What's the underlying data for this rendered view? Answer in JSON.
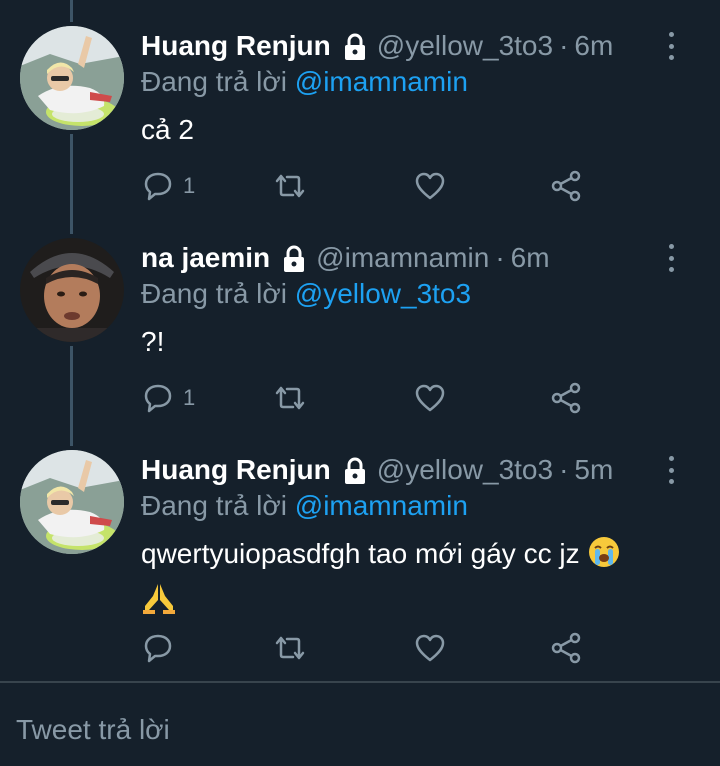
{
  "tweets": [
    {
      "name": "Huang Renjun",
      "handle": "@yellow_3to3",
      "separator": "·",
      "time": "6m",
      "replying_prefix": "Đang trả lời",
      "replying_to": "@imamnamin",
      "text": "cả 2",
      "reply_count": "1",
      "avatar": "avatar-renjun"
    },
    {
      "name": "na jaemin",
      "handle": "@imamnamin",
      "separator": "·",
      "time": "6m",
      "replying_prefix": "Đang trả lời",
      "replying_to": "@yellow_3to3",
      "text": "?!",
      "reply_count": "1",
      "avatar": "avatar-jaemin"
    },
    {
      "name": "Huang Renjun",
      "handle": "@yellow_3to3",
      "separator": "·",
      "time": "5m",
      "replying_prefix": "Đang trả lời",
      "replying_to": "@imamnamin",
      "text": "qwertyuiopasdfgh tao mới gáy cc jz",
      "reply_count": "",
      "avatar": "avatar-renjun",
      "emojis": [
        "loudly-crying-face",
        "folded-hands"
      ]
    }
  ],
  "composer": {
    "placeholder": "Tweet trả lời"
  },
  "colors": {
    "background": "#15202b",
    "secondary_text": "#8899a6",
    "link": "#1da1f2",
    "divider": "#38444d"
  }
}
